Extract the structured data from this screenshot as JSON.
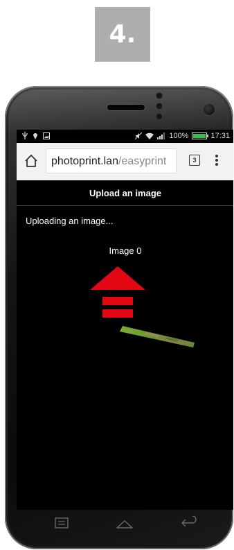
{
  "step": {
    "number": "4."
  },
  "status_bar": {
    "battery": "100%",
    "time": "17:31"
  },
  "browser": {
    "url_host": "photoprint.lan",
    "url_path": "/easyprint",
    "tab_count": "3"
  },
  "page": {
    "header": "Upload an image",
    "status_text": "Uploading an image...",
    "image_label": "Image 0"
  },
  "colors": {
    "arrow_red": "#e30613",
    "battery_green": "#34c24a",
    "url_path_gray": "#8a8a8a"
  },
  "icons": {
    "status_left": [
      "usb-icon",
      "location-icon",
      "gallery-notification-icon"
    ],
    "status_right": [
      "mute-icon",
      "wifi-icon",
      "signal-icon",
      "battery-icon"
    ],
    "browser": [
      "home-icon",
      "tabs-icon",
      "overflow-menu-icon"
    ],
    "navigation": [
      "recent-apps-icon",
      "home-nav-icon",
      "back-icon"
    ]
  }
}
